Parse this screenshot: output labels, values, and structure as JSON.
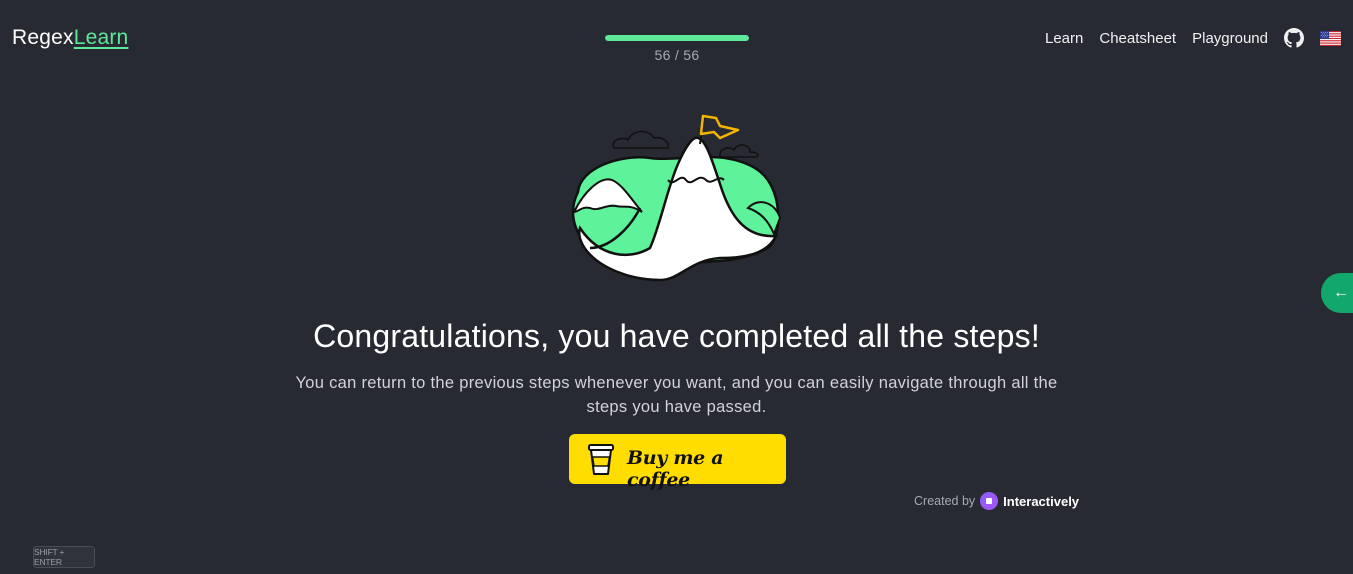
{
  "header": {
    "logo_part1": "Regex",
    "logo_part2": "Learn",
    "progress": {
      "text": "56 / 56",
      "fraction": 1.0
    },
    "nav": {
      "learn": "Learn",
      "cheatsheet": "Cheatsheet",
      "playground": "Playground",
      "github_icon": "github-icon",
      "language_icon": "us-flag-icon"
    }
  },
  "main": {
    "title": "Congratulations, you have completed all the steps!",
    "subtitle": "You can return to the previous steps whenever you want, and you can easily navigate through all the steps you have passed.",
    "coffee_button": "Buy me a coffee",
    "created_by": "Created by",
    "brand": "Interactively"
  },
  "shortcut_hint": "SHIFT + ENTER",
  "side_tab_icon": "arrow-left-icon",
  "colors": {
    "background": "#272a32",
    "accent": "#5ee89a",
    "coffee": "#ffdd00",
    "side_tab": "#13a86b"
  }
}
